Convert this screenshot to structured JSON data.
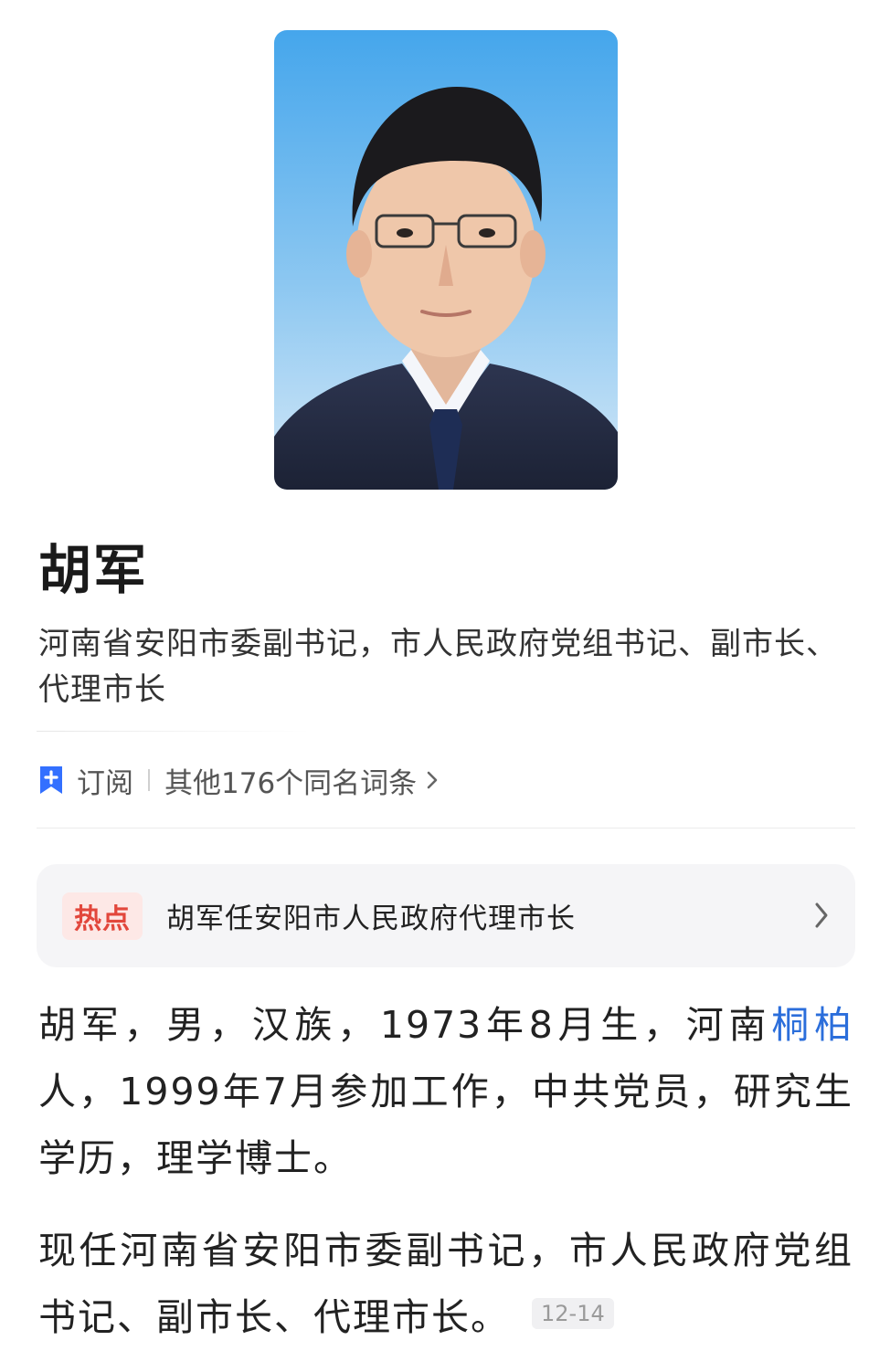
{
  "profile": {
    "name": "胡军",
    "subtitle": "河南省安阳市委副书记，市人民政府党组书记、副市长、代理市长"
  },
  "meta": {
    "subscribe_label": "订阅",
    "same_name_label": "其他176个同名词条"
  },
  "hot": {
    "badge": "热点",
    "headline": "胡军任安阳市人民政府代理市长"
  },
  "bio": {
    "p1_before_link": "胡军，男，汉族，1973年8月生，河南",
    "p1_link": "桐柏",
    "p1_after_link": "人，1999年7月参加工作，中共党员，研究生学历，理学博士。",
    "p2_text": "现任河南省安阳市委副书记，市人民政府党组书记、副市长、代理市长。",
    "p2_date": "12-14"
  },
  "colors": {
    "link": "#2b6edb",
    "accent_icon": "#3370ff",
    "hot_badge_text": "#e2473c",
    "hot_badge_bg": "#fde8e6",
    "portrait_bg_top": "#45a6ec",
    "portrait_bg_bottom": "#d4e8f7"
  }
}
